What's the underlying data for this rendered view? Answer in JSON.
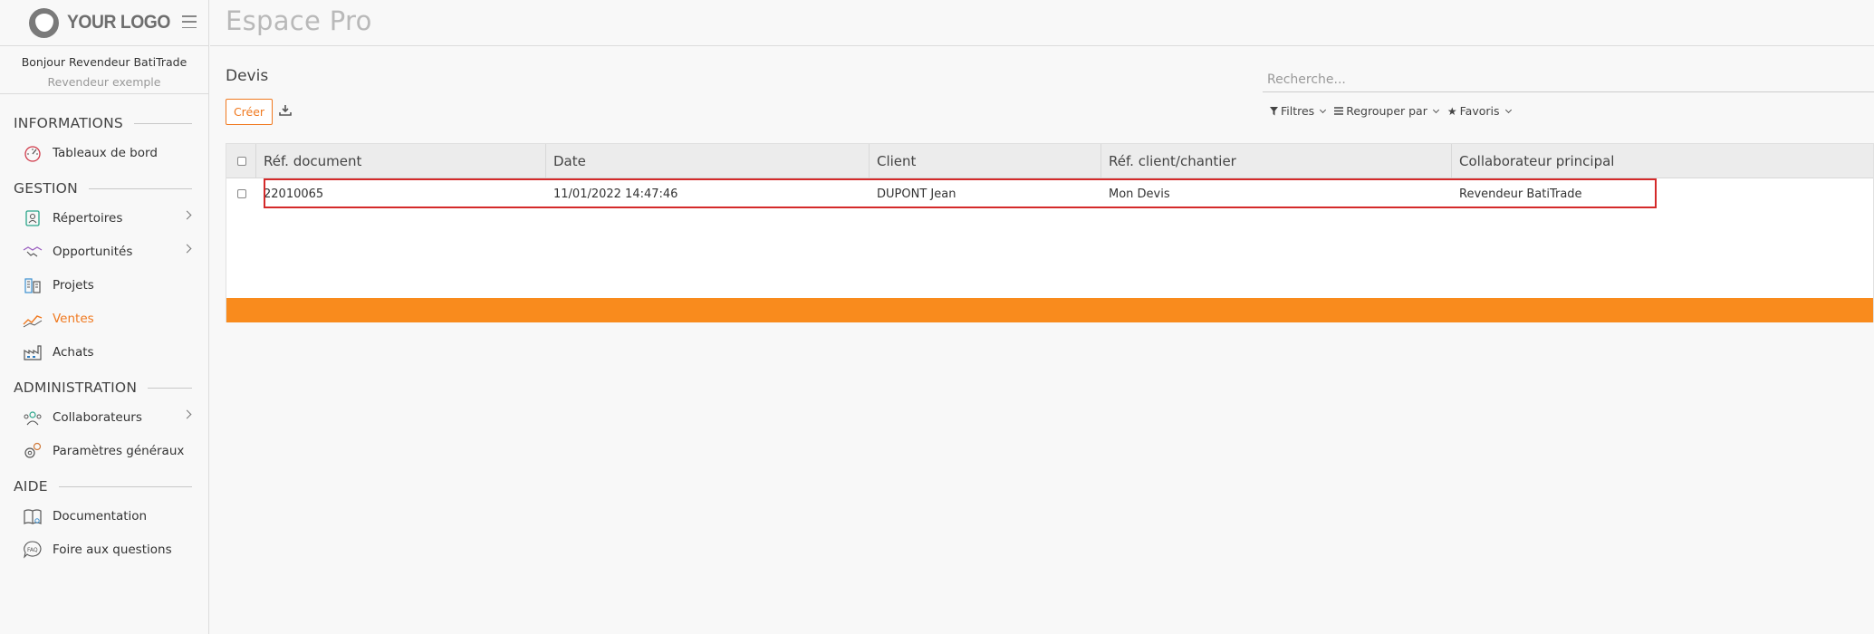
{
  "brand": {
    "logo_text": "YOUR LOGO"
  },
  "user": {
    "greeting": "Bonjour Revendeur BatiTrade",
    "role": "Revendeur exemple"
  },
  "sidebar": {
    "sections": [
      {
        "title": "INFORMATIONS",
        "items": [
          {
            "label": "Tableaux de bord",
            "icon": "dashboard-icon"
          }
        ]
      },
      {
        "title": "GESTION",
        "items": [
          {
            "label": "Répertoires",
            "icon": "contacts-icon",
            "has_children": true
          },
          {
            "label": "Opportunités",
            "icon": "handshake-icon",
            "has_children": true
          },
          {
            "label": "Projets",
            "icon": "projects-icon"
          },
          {
            "label": "Ventes",
            "icon": "sales-chart-icon",
            "active": true
          },
          {
            "label": "Achats",
            "icon": "factory-icon"
          }
        ]
      },
      {
        "title": "ADMINISTRATION",
        "items": [
          {
            "label": "Collaborateurs",
            "icon": "team-icon",
            "has_children": true
          },
          {
            "label": "Paramètres généraux",
            "icon": "gears-icon"
          }
        ]
      },
      {
        "title": "AIDE",
        "items": [
          {
            "label": "Documentation",
            "icon": "book-icon"
          },
          {
            "label": "Foire aux questions",
            "icon": "faq-icon"
          }
        ]
      }
    ]
  },
  "header": {
    "title": "Espace Pro"
  },
  "main": {
    "title": "Devis",
    "create_label": "Créer",
    "search": {
      "placeholder": "Recherche..."
    },
    "filters": {
      "filter_label": "Filtres",
      "group_label": "Regrouper par",
      "favorites_label": "Favoris"
    }
  },
  "table": {
    "columns": [
      "Réf. document",
      "Date",
      "Client",
      "Réf. client/chantier",
      "Collaborateur principal"
    ],
    "rows": [
      [
        "22010065",
        "11/01/2022 14:47:46",
        "DUPONT Jean",
        "Mon Devis",
        "Revendeur BatiTrade"
      ]
    ]
  },
  "colors": {
    "accent": "#f0791f",
    "bar": "#f98b1d",
    "highlight": "#d42a2a"
  }
}
